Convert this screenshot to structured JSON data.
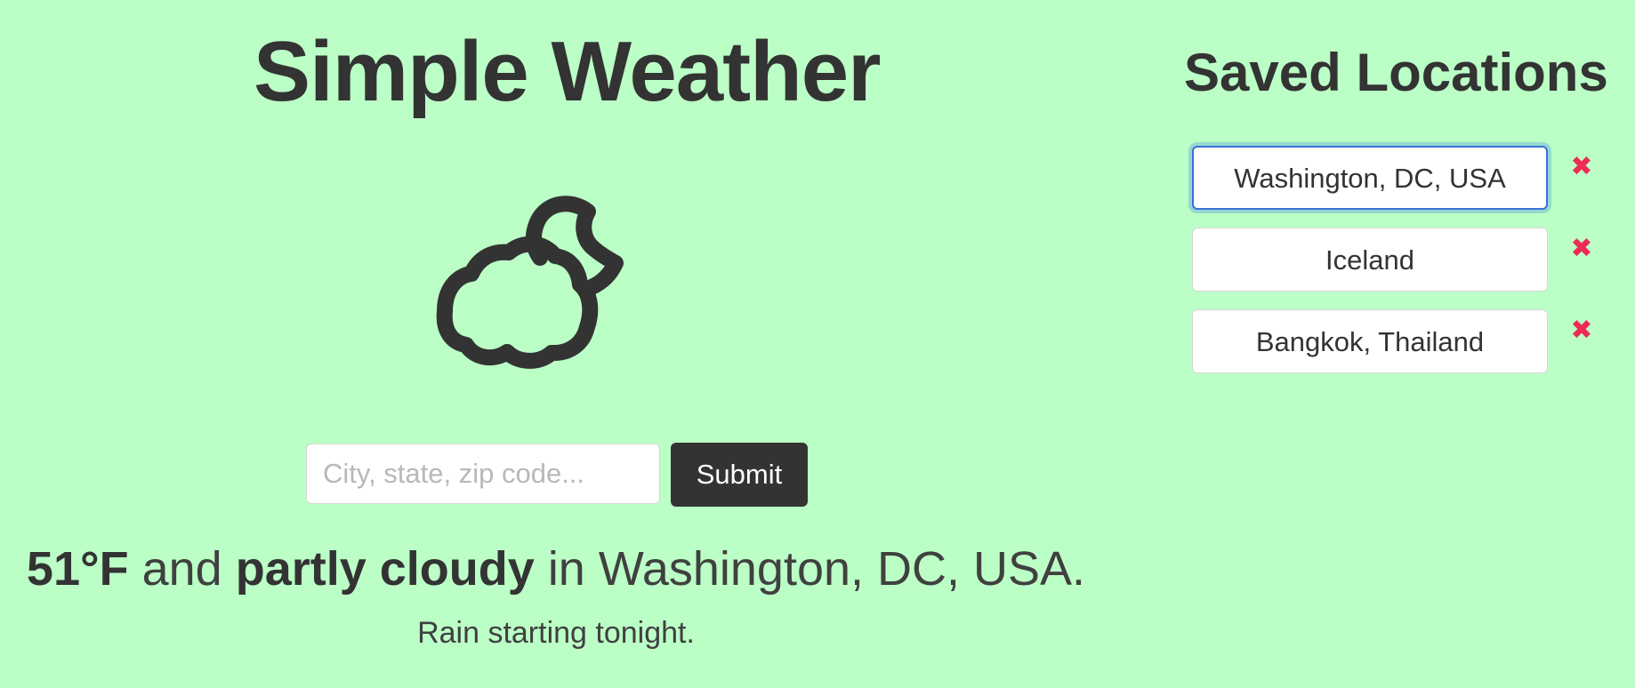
{
  "app": {
    "title": "Simple Weather"
  },
  "current": {
    "icon": "partly-cloudy-night-icon",
    "temperature": "51°F",
    "connector_and": "and",
    "condition": "partly cloudy",
    "connector_in": "in",
    "location": "Washington, DC, USA.",
    "forecast": "Rain starting tonight."
  },
  "search": {
    "placeholder": "City, state, zip code...",
    "value": "",
    "submit_label": "Submit"
  },
  "saved": {
    "title": "Saved Locations",
    "remove_icon": "close-icon",
    "remove_symbol": "✖",
    "items": [
      {
        "label": "Washington, DC, USA",
        "active": true
      },
      {
        "label": "Iceland",
        "active": false
      },
      {
        "label": "Bangkok, Thailand",
        "active": false
      }
    ]
  },
  "colors": {
    "background": "#bbffc6",
    "text": "#333333",
    "button": "#333333",
    "remove": "#ec2c55",
    "focus_border": "#3b6fd6"
  }
}
